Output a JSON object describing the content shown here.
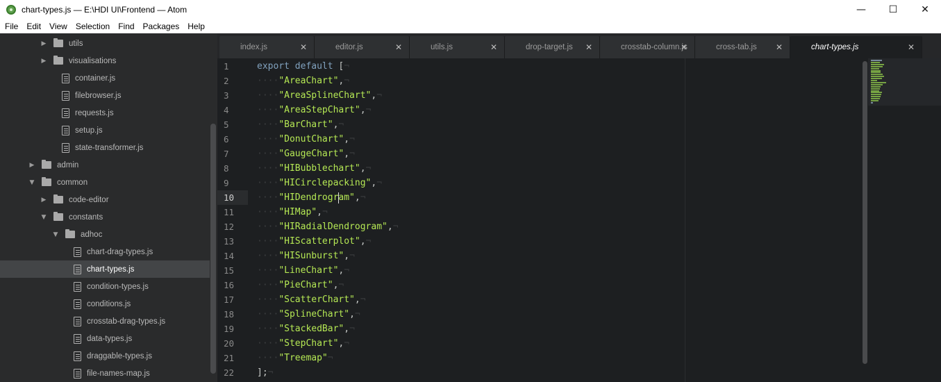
{
  "window": {
    "title": "chart-types.js — E:\\HDI UI\\Frontend — Atom",
    "minimize": "—",
    "maximize": "☐",
    "close": "✕"
  },
  "menu": [
    "File",
    "Edit",
    "View",
    "Selection",
    "Find",
    "Packages",
    "Help"
  ],
  "tree": [
    {
      "type": "folder",
      "label": "utils",
      "level": 3,
      "expanded": false
    },
    {
      "type": "folder",
      "label": "visualisations",
      "level": 3,
      "expanded": false
    },
    {
      "type": "file",
      "label": "container.js",
      "level": 3
    },
    {
      "type": "file",
      "label": "filebrowser.js",
      "level": 3
    },
    {
      "type": "file",
      "label": "requests.js",
      "level": 3
    },
    {
      "type": "file",
      "label": "setup.js",
      "level": 3
    },
    {
      "type": "file",
      "label": "state-transformer.js",
      "level": 3
    },
    {
      "type": "folder",
      "label": "admin",
      "level": 2,
      "expanded": false
    },
    {
      "type": "folder",
      "label": "common",
      "level": 2,
      "expanded": true
    },
    {
      "type": "folder",
      "label": "code-editor",
      "level": 3,
      "expanded": false
    },
    {
      "type": "folder",
      "label": "constants",
      "level": 3,
      "expanded": true
    },
    {
      "type": "folder",
      "label": "adhoc",
      "level": 4,
      "expanded": true
    },
    {
      "type": "file",
      "label": "chart-drag-types.js",
      "level": 5
    },
    {
      "type": "file",
      "label": "chart-types.js",
      "level": 5,
      "selected": true
    },
    {
      "type": "file",
      "label": "condition-types.js",
      "level": 5
    },
    {
      "type": "file",
      "label": "conditions.js",
      "level": 5
    },
    {
      "type": "file",
      "label": "crosstab-drag-types.js",
      "level": 5
    },
    {
      "type": "file",
      "label": "data-types.js",
      "level": 5
    },
    {
      "type": "file",
      "label": "draggable-types.js",
      "level": 5
    },
    {
      "type": "file",
      "label": "file-names-map.js",
      "level": 5
    }
  ],
  "tabs": [
    {
      "label": "index.js",
      "active": false
    },
    {
      "label": "editor.js",
      "active": false
    },
    {
      "label": "utils.js",
      "active": false
    },
    {
      "label": "drop-target.js",
      "active": false
    },
    {
      "label": "crosstab-column.js",
      "active": false
    },
    {
      "label": "cross-tab.js",
      "active": false
    },
    {
      "label": "chart-types.js",
      "active": true
    }
  ],
  "tab_close": "✕",
  "editor": {
    "current_line": 10,
    "cursor_line": 10,
    "cursor_col": 11,
    "keyword_export": "export",
    "keyword_default": "default",
    "open_bracket": "[",
    "close_bracket": "];",
    "indent_marker": "····",
    "eol_marker": "¬",
    "strings": [
      "AreaChart",
      "AreaSplineChart",
      "AreaStepChart",
      "BarChart",
      "DonutChart",
      "GaugeChart",
      "HIBubblechart",
      "HICirclepacking",
      "HIDendrogram",
      "HIMap",
      "HIRadialDendrogram",
      "HIScatterplot",
      "HISunburst",
      "LineChart",
      "PieChart",
      "ScatterChart",
      "SplineChart",
      "StackedBar",
      "StepChart",
      "Treemap"
    ]
  },
  "colors": {
    "keyword": "#81a2be",
    "string": "#b5e854",
    "background": "#1d1f21",
    "sidebar": "#2a2b2c"
  }
}
